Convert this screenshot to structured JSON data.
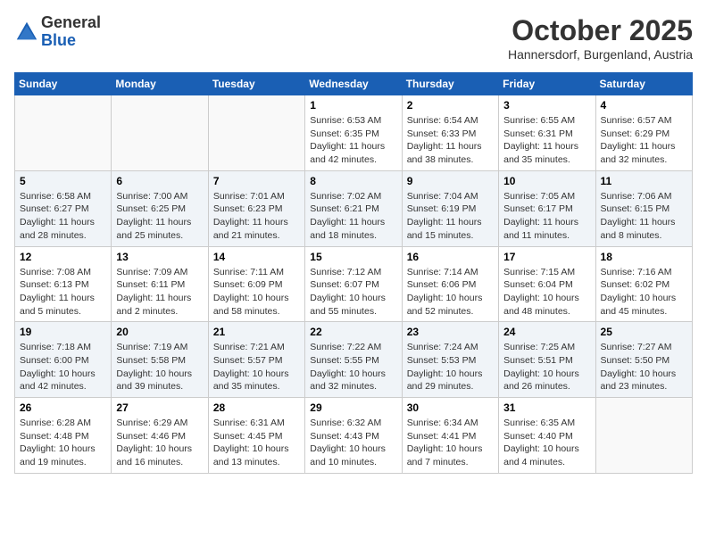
{
  "header": {
    "logo_general": "General",
    "logo_blue": "Blue",
    "month_title": "October 2025",
    "subtitle": "Hannersdorf, Burgenland, Austria"
  },
  "days_of_week": [
    "Sunday",
    "Monday",
    "Tuesday",
    "Wednesday",
    "Thursday",
    "Friday",
    "Saturday"
  ],
  "weeks": [
    {
      "days": [
        {
          "number": "",
          "info": ""
        },
        {
          "number": "",
          "info": ""
        },
        {
          "number": "",
          "info": ""
        },
        {
          "number": "1",
          "info": "Sunrise: 6:53 AM\nSunset: 6:35 PM\nDaylight: 11 hours and 42 minutes."
        },
        {
          "number": "2",
          "info": "Sunrise: 6:54 AM\nSunset: 6:33 PM\nDaylight: 11 hours and 38 minutes."
        },
        {
          "number": "3",
          "info": "Sunrise: 6:55 AM\nSunset: 6:31 PM\nDaylight: 11 hours and 35 minutes."
        },
        {
          "number": "4",
          "info": "Sunrise: 6:57 AM\nSunset: 6:29 PM\nDaylight: 11 hours and 32 minutes."
        }
      ]
    },
    {
      "days": [
        {
          "number": "5",
          "info": "Sunrise: 6:58 AM\nSunset: 6:27 PM\nDaylight: 11 hours and 28 minutes."
        },
        {
          "number": "6",
          "info": "Sunrise: 7:00 AM\nSunset: 6:25 PM\nDaylight: 11 hours and 25 minutes."
        },
        {
          "number": "7",
          "info": "Sunrise: 7:01 AM\nSunset: 6:23 PM\nDaylight: 11 hours and 21 minutes."
        },
        {
          "number": "8",
          "info": "Sunrise: 7:02 AM\nSunset: 6:21 PM\nDaylight: 11 hours and 18 minutes."
        },
        {
          "number": "9",
          "info": "Sunrise: 7:04 AM\nSunset: 6:19 PM\nDaylight: 11 hours and 15 minutes."
        },
        {
          "number": "10",
          "info": "Sunrise: 7:05 AM\nSunset: 6:17 PM\nDaylight: 11 hours and 11 minutes."
        },
        {
          "number": "11",
          "info": "Sunrise: 7:06 AM\nSunset: 6:15 PM\nDaylight: 11 hours and 8 minutes."
        }
      ]
    },
    {
      "days": [
        {
          "number": "12",
          "info": "Sunrise: 7:08 AM\nSunset: 6:13 PM\nDaylight: 11 hours and 5 minutes."
        },
        {
          "number": "13",
          "info": "Sunrise: 7:09 AM\nSunset: 6:11 PM\nDaylight: 11 hours and 2 minutes."
        },
        {
          "number": "14",
          "info": "Sunrise: 7:11 AM\nSunset: 6:09 PM\nDaylight: 10 hours and 58 minutes."
        },
        {
          "number": "15",
          "info": "Sunrise: 7:12 AM\nSunset: 6:07 PM\nDaylight: 10 hours and 55 minutes."
        },
        {
          "number": "16",
          "info": "Sunrise: 7:14 AM\nSunset: 6:06 PM\nDaylight: 10 hours and 52 minutes."
        },
        {
          "number": "17",
          "info": "Sunrise: 7:15 AM\nSunset: 6:04 PM\nDaylight: 10 hours and 48 minutes."
        },
        {
          "number": "18",
          "info": "Sunrise: 7:16 AM\nSunset: 6:02 PM\nDaylight: 10 hours and 45 minutes."
        }
      ]
    },
    {
      "days": [
        {
          "number": "19",
          "info": "Sunrise: 7:18 AM\nSunset: 6:00 PM\nDaylight: 10 hours and 42 minutes."
        },
        {
          "number": "20",
          "info": "Sunrise: 7:19 AM\nSunset: 5:58 PM\nDaylight: 10 hours and 39 minutes."
        },
        {
          "number": "21",
          "info": "Sunrise: 7:21 AM\nSunset: 5:57 PM\nDaylight: 10 hours and 35 minutes."
        },
        {
          "number": "22",
          "info": "Sunrise: 7:22 AM\nSunset: 5:55 PM\nDaylight: 10 hours and 32 minutes."
        },
        {
          "number": "23",
          "info": "Sunrise: 7:24 AM\nSunset: 5:53 PM\nDaylight: 10 hours and 29 minutes."
        },
        {
          "number": "24",
          "info": "Sunrise: 7:25 AM\nSunset: 5:51 PM\nDaylight: 10 hours and 26 minutes."
        },
        {
          "number": "25",
          "info": "Sunrise: 7:27 AM\nSunset: 5:50 PM\nDaylight: 10 hours and 23 minutes."
        }
      ]
    },
    {
      "days": [
        {
          "number": "26",
          "info": "Sunrise: 6:28 AM\nSunset: 4:48 PM\nDaylight: 10 hours and 19 minutes."
        },
        {
          "number": "27",
          "info": "Sunrise: 6:29 AM\nSunset: 4:46 PM\nDaylight: 10 hours and 16 minutes."
        },
        {
          "number": "28",
          "info": "Sunrise: 6:31 AM\nSunset: 4:45 PM\nDaylight: 10 hours and 13 minutes."
        },
        {
          "number": "29",
          "info": "Sunrise: 6:32 AM\nSunset: 4:43 PM\nDaylight: 10 hours and 10 minutes."
        },
        {
          "number": "30",
          "info": "Sunrise: 6:34 AM\nSunset: 4:41 PM\nDaylight: 10 hours and 7 minutes."
        },
        {
          "number": "31",
          "info": "Sunrise: 6:35 AM\nSunset: 4:40 PM\nDaylight: 10 hours and 4 minutes."
        },
        {
          "number": "",
          "info": ""
        }
      ]
    }
  ]
}
